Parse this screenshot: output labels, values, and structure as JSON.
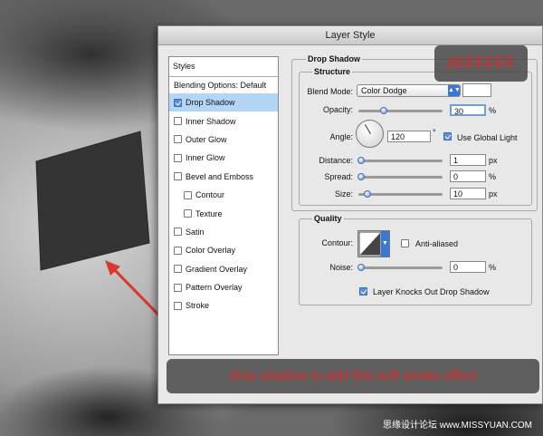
{
  "dialog": {
    "title": "Layer Style",
    "styles_header": "Styles",
    "blending_options": "Blending Options: Default",
    "items": [
      {
        "label": "Drop Shadow",
        "checked": true,
        "selected": true,
        "indent": false
      },
      {
        "label": "Inner Shadow",
        "checked": false,
        "selected": false,
        "indent": false
      },
      {
        "label": "Outer Glow",
        "checked": false,
        "selected": false,
        "indent": false
      },
      {
        "label": "Inner Glow",
        "checked": false,
        "selected": false,
        "indent": false
      },
      {
        "label": "Bevel and Emboss",
        "checked": false,
        "selected": false,
        "indent": false
      },
      {
        "label": "Contour",
        "checked": false,
        "selected": false,
        "indent": true
      },
      {
        "label": "Texture",
        "checked": false,
        "selected": false,
        "indent": true
      },
      {
        "label": "Satin",
        "checked": false,
        "selected": false,
        "indent": false
      },
      {
        "label": "Color Overlay",
        "checked": false,
        "selected": false,
        "indent": false
      },
      {
        "label": "Gradient Overlay",
        "checked": false,
        "selected": false,
        "indent": false
      },
      {
        "label": "Pattern Overlay",
        "checked": false,
        "selected": false,
        "indent": false
      },
      {
        "label": "Stroke",
        "checked": false,
        "selected": false,
        "indent": false
      }
    ]
  },
  "drop_shadow": {
    "section_title": "Drop Shadow",
    "structure_title": "Structure",
    "blend_mode_label": "Blend Mode:",
    "blend_mode_value": "Color Dodge",
    "swatch_color": "#FFFFFF",
    "opacity_label": "Opacity:",
    "opacity_value": "30",
    "opacity_unit": "%",
    "opacity_fraction": 0.3,
    "angle_label": "Angle:",
    "angle_value": "120",
    "angle_unit": "°",
    "use_global_light_label": "Use Global Light",
    "use_global_light": true,
    "distance_label": "Distance:",
    "distance_value": "1",
    "distance_unit": "px",
    "spread_label": "Spread:",
    "spread_value": "0",
    "spread_unit": "%",
    "size_label": "Size:",
    "size_value": "10",
    "size_unit": "px"
  },
  "quality": {
    "title": "Quality",
    "contour_label": "Contour:",
    "anti_aliased_label": "Anti-aliased",
    "anti_aliased": false,
    "noise_label": "Noise:",
    "noise_value": "0",
    "noise_unit": "%",
    "knockout_label": "Layer Knocks Out Drop Shadow",
    "knockout": true
  },
  "annotations": {
    "hex_label": "#FFFFFF",
    "caption": "drop shadow to add this soft stroke effect",
    "watermark": "思缘设计论坛 www.MISSYUAN.COM",
    "accent_color": "#e0282a"
  }
}
